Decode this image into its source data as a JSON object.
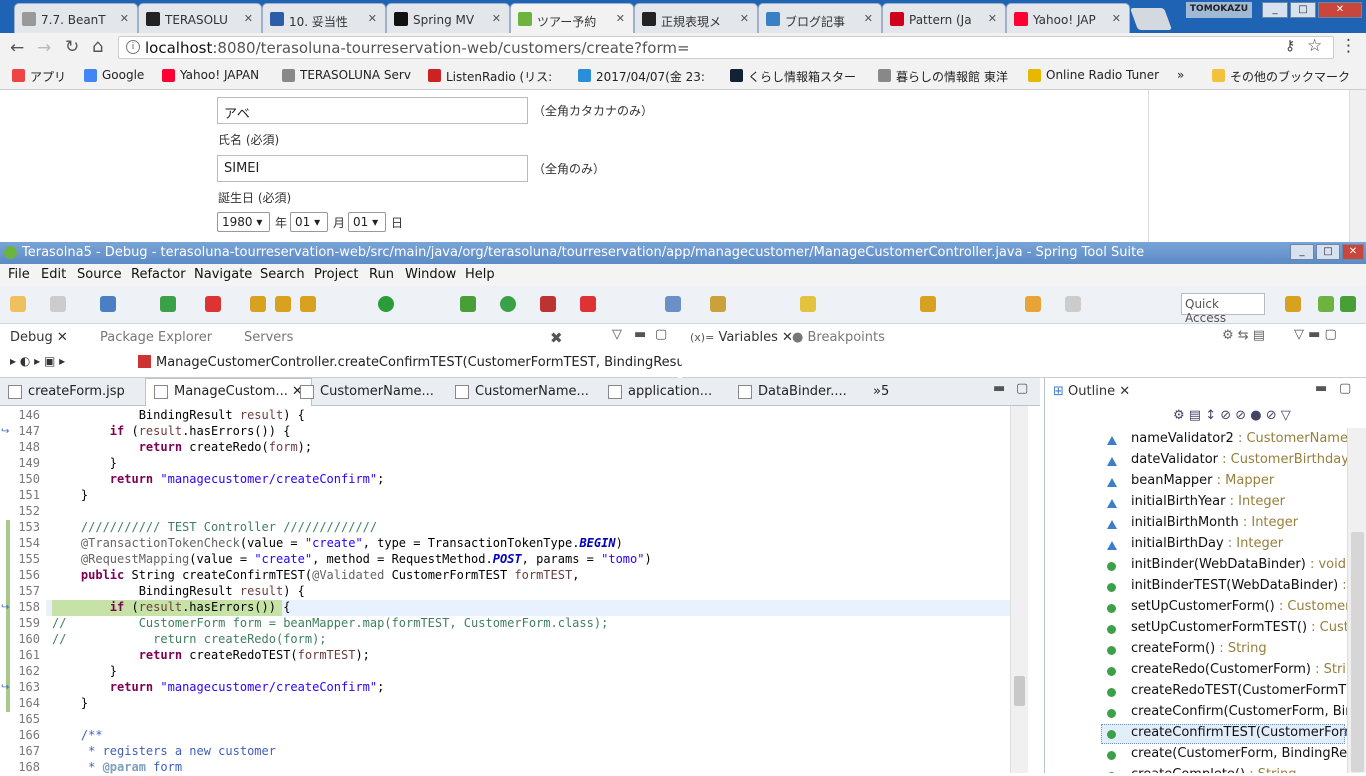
{
  "browser": {
    "tabs": [
      {
        "label": "7.7. BeanT",
        "color": "#999"
      },
      {
        "label": "TERASOLU",
        "color": "#222"
      },
      {
        "label": "10. 妥当性",
        "color": "#2c5ea8"
      },
      {
        "label": "Spring MV",
        "color": "#111"
      },
      {
        "label": "ツアー予約",
        "color": "#6db33f"
      },
      {
        "label": "正規表現メ",
        "color": "#222"
      },
      {
        "label": "ブログ記事",
        "color": "#3b7fc4"
      },
      {
        "label": "Pattern (Ja",
        "color": "#d0021b"
      },
      {
        "label": "Yahoo! JAP",
        "color": "#ff0033"
      }
    ],
    "user_badge": "TOMOKAZU",
    "url_host": "localhost",
    "url_rest": ":8080/terasoluna-tourreservation-web/customers/create?form=",
    "bookmarks": [
      {
        "label": "アプリ",
        "color": "#e44"
      },
      {
        "label": "Google",
        "color": "#4285f4"
      },
      {
        "label": "Yahoo! JAPAN",
        "color": "#ff0033"
      },
      {
        "label": "TERASOLUNA Serv",
        "color": "#888"
      },
      {
        "label": "ListenRadio (リス:",
        "color": "#c22"
      },
      {
        "label": "2017/04/07(金 23:",
        "color": "#2a8fd6"
      },
      {
        "label": "くらし情報箱スター",
        "color": "#123"
      },
      {
        "label": "暮らしの情報館 東洋",
        "color": "#888"
      },
      {
        "label": "Online Radio Tuner",
        "color": "#e6b800"
      },
      {
        "label": "»",
        "color": ""
      },
      {
        "label": "その他のブックマーク",
        "color": "#f3c23d"
      }
    ]
  },
  "form": {
    "kana_value": "アベ",
    "kana_hint": "（全角カタカナのみ）",
    "name_label": "氏名 (必須)",
    "name_value": "SIMEI",
    "name_hint": "（全角のみ）",
    "birth_label": "誕生日 (必須)",
    "year": "1980",
    "year_unit": "年",
    "month": "01",
    "month_unit": "月",
    "day": "01",
    "day_unit": "日"
  },
  "eclipse": {
    "title": "Terasolna5 - Debug - terasoluna-tourreservation-web/src/main/java/org/terasoluna/tourreservation/app/managecustomer/ManageCustomerController.java - Spring Tool Suite",
    "menu": [
      "File",
      "Edit",
      "Source",
      "Refactor",
      "Navigate",
      "Search",
      "Project",
      "Run",
      "Window",
      "Help"
    ],
    "quick_access": "Quick Access",
    "views_left": [
      "Debug",
      "Package Explorer",
      "Servers"
    ],
    "debug_frame": "ManageCustomerController.createConfirmTEST(CustomerFormTEST, BindingResult) line:",
    "views_right": [
      "Variables",
      "Breakpoints"
    ],
    "editor_tabs": [
      "createForm.jsp",
      "ManageCustom...",
      "CustomerName...",
      "CustomerName...",
      "application...",
      "DataBinder....",
      "»5"
    ],
    "outline_tab": "Outline",
    "outline": [
      {
        "name": "nameValidator2",
        "type": " : CustomerNameVal",
        "kind": "field"
      },
      {
        "name": "dateValidator",
        "type": " : CustomerBirthdayVal",
        "kind": "field"
      },
      {
        "name": "beanMapper",
        "type": " : Mapper",
        "kind": "field"
      },
      {
        "name": "initialBirthYear",
        "type": " : Integer",
        "kind": "field"
      },
      {
        "name": "initialBirthMonth",
        "type": " : Integer",
        "kind": "field"
      },
      {
        "name": "initialBirthDay",
        "type": " : Integer",
        "kind": "field"
      },
      {
        "name": "initBinder(WebDataBinder)",
        "type": " : void",
        "kind": "method"
      },
      {
        "name": "initBinderTEST(WebDataBinder)",
        "type": " : vo",
        "kind": "method"
      },
      {
        "name": "setUpCustomerForm()",
        "type": " : CustomerFo",
        "kind": "method"
      },
      {
        "name": "setUpCustomerFormTEST()",
        "type": " : Custor",
        "kind": "method"
      },
      {
        "name": "createForm()",
        "type": " : String",
        "kind": "method"
      },
      {
        "name": "createRedo(CustomerForm)",
        "type": " : String",
        "kind": "method"
      },
      {
        "name": "createRedoTEST(CustomerFormTES",
        "type": "",
        "kind": "method"
      },
      {
        "name": "createConfirm(CustomerForm, Bindi",
        "type": "",
        "kind": "method"
      },
      {
        "name": "createConfirmTEST(CustomerFormT",
        "type": "",
        "kind": "method"
      },
      {
        "name": "create(CustomerForm, BindingResul",
        "type": "",
        "kind": "method"
      },
      {
        "name": "createComplete()",
        "type": " : String",
        "kind": "method"
      }
    ],
    "line_numbers": [
      "146",
      "147",
      "148",
      "149",
      "150",
      "151",
      "152",
      "153",
      "154",
      "155",
      "156",
      "157",
      "158",
      "159",
      "160",
      "161",
      "162",
      "163",
      "164",
      "165",
      "166",
      "167",
      "168"
    ]
  }
}
